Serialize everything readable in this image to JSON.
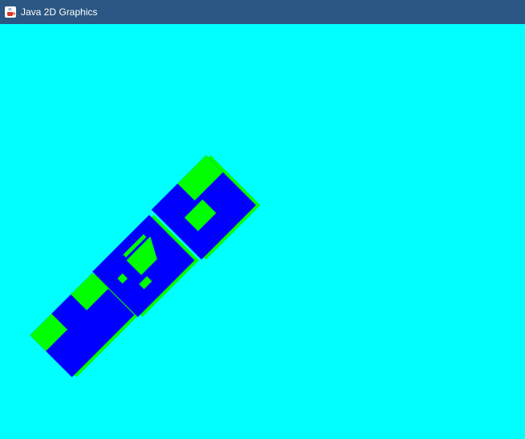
{
  "window": {
    "title": "Java 2D Graphics",
    "icon": "java-cup-icon"
  },
  "canvas": {
    "background_color": "#00ffff",
    "shape_fill_color": "#0000ff",
    "shape_highlight_color": "#00ff00"
  }
}
